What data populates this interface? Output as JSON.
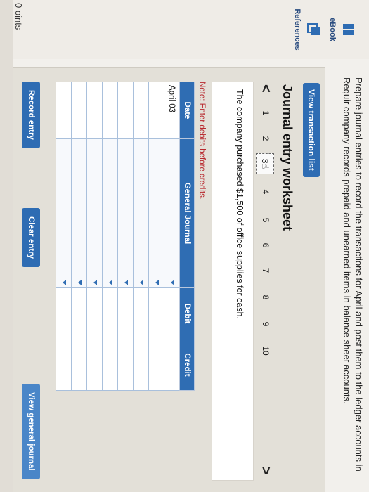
{
  "header": {
    "points_label": "0 oints",
    "instructions": "Prepare journal entries to record the transactions for April and post them to the ledger accounts in Requir company records prepaid and unearned items in balance sheet accounts."
  },
  "sidebar": {
    "items": [
      {
        "label": "eBook",
        "icon": "book-icon"
      },
      {
        "label": "References",
        "icon": "references-icon"
      }
    ]
  },
  "worksheet": {
    "view_transactions_label": "View transaction list",
    "title": "Journal entry worksheet",
    "pager": {
      "prev": "<",
      "next": ">",
      "pages": [
        "1",
        "2",
        "3",
        "4",
        "5",
        "6",
        "7",
        "8",
        "9",
        "10"
      ],
      "active_page": "3"
    },
    "question": "The company purchased $1,500 of office supplies for cash.",
    "note": "Note: Enter debits before credits.",
    "table": {
      "headers": [
        "Date",
        "General Journal",
        "Debit",
        "Credit"
      ],
      "date_first_row": "April 03"
    },
    "buttons": {
      "record": "Record entry",
      "clear": "Clear entry",
      "view_general": "View general journal"
    }
  },
  "colors": {
    "accent": "#2e6cb3",
    "note_red": "#b8282e"
  }
}
